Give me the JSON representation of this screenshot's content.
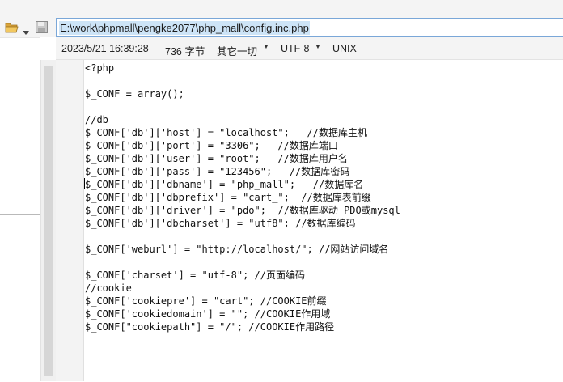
{
  "toolbar": {
    "icons": [
      "folder-open-icon",
      "dropdown-arrow-icon",
      "save-icon"
    ],
    "path": "E:\\work\\phpmall\\pengke2077\\php_mall\\config.inc.php"
  },
  "status": {
    "datetime": "2023/5/21 16:39:28",
    "size": "736 字节",
    "syntax": "其它一切",
    "encoding": "UTF-8",
    "line_ending": "UNIX"
  },
  "code_lines": [
    "<?php",
    "",
    "$_CONF = array();",
    "",
    "//db",
    "$_CONF['db']['host'] = \"localhost\";   //数据库主机",
    "$_CONF['db']['port'] = \"3306\";   //数据库端口",
    "$_CONF['db']['user'] = \"root\";   //数据库用户名",
    "$_CONF['db']['pass'] = \"123456\";   //数据库密码",
    "$_CONF['db']['dbname'] = \"php_mall\";   //数据库名",
    "$_CONF['db']['dbprefix'] = \"cart_\";  //数据库表前缀",
    "$_CONF['db']['driver'] = \"pdo\";  //数据库驱动 PDO或mysql",
    "$_CONF['db']['dbcharset'] = \"utf8\"; //数据库编码",
    "",
    "$_CONF['weburl'] = \"http://localhost/\"; //网站访问域名",
    "",
    "$_CONF['charset'] = \"utf-8\"; //页面编码",
    "//cookie",
    "$_CONF['cookiepre'] = \"cart\"; //COOKIE前缀",
    "$_CONF['cookiedomain'] = \"\"; //COOKIE作用域",
    "$_CONF[\"cookiepath\"] = \"/\"; //COOKIE作用路径"
  ],
  "colors": {
    "path_highlight": "#cde4f7",
    "folder": "#e8b84a",
    "toolbar_bg": "#f4f4f4"
  }
}
